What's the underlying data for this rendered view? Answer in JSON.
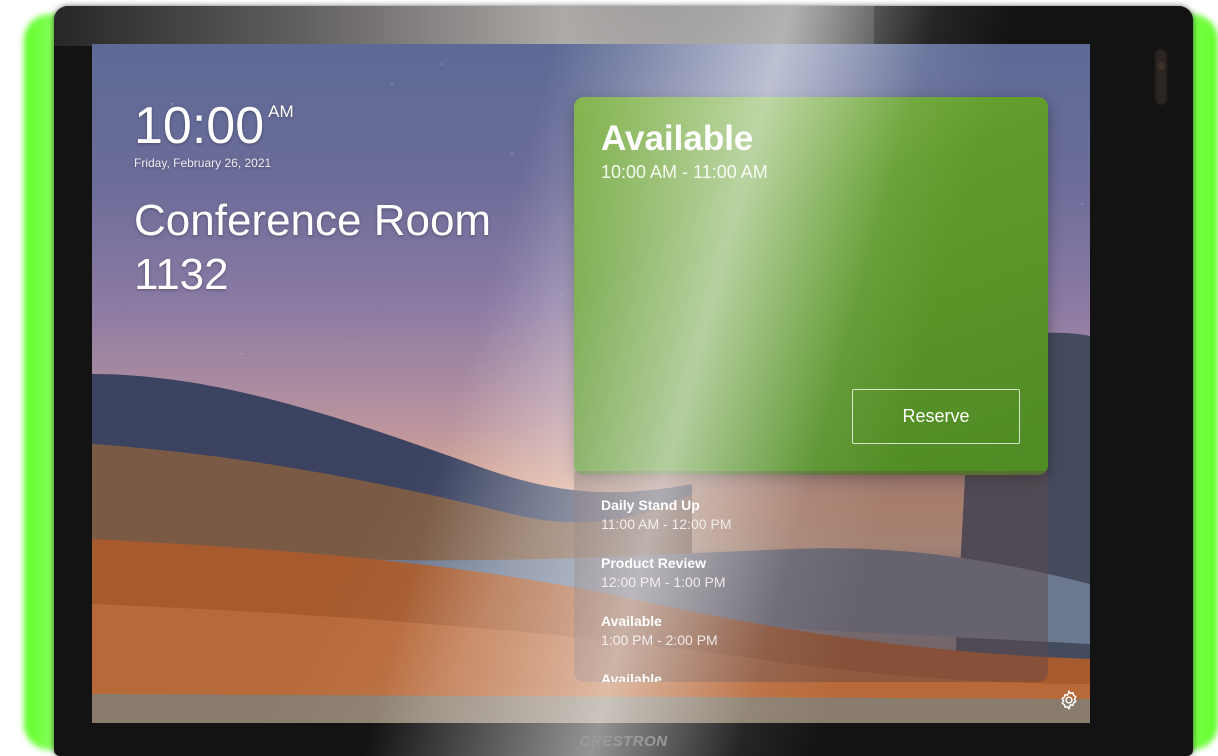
{
  "device": {
    "brand": "CRESTRON"
  },
  "clock": {
    "time": "10:00",
    "ampm": "AM",
    "date": "Friday, February 26, 2021"
  },
  "room": {
    "name_line1": "Conference Room",
    "name_line2": "1132"
  },
  "status": {
    "title": "Available",
    "time_range": "10:00 AM - 11:00 AM",
    "reserve_label": "Reserve",
    "color": "#5f9b2b"
  },
  "schedule": [
    {
      "title": "Daily Stand Up",
      "time": "11:00 AM - 12:00 PM"
    },
    {
      "title": "Product Review",
      "time": "12:00 PM - 1:00 PM"
    },
    {
      "title": "Available",
      "time": "1:00 PM - 2:00 PM"
    },
    {
      "title": "Available",
      "time": ""
    }
  ],
  "icons": {
    "settings": "gear-icon"
  },
  "colors": {
    "led": "#62ff2a"
  }
}
